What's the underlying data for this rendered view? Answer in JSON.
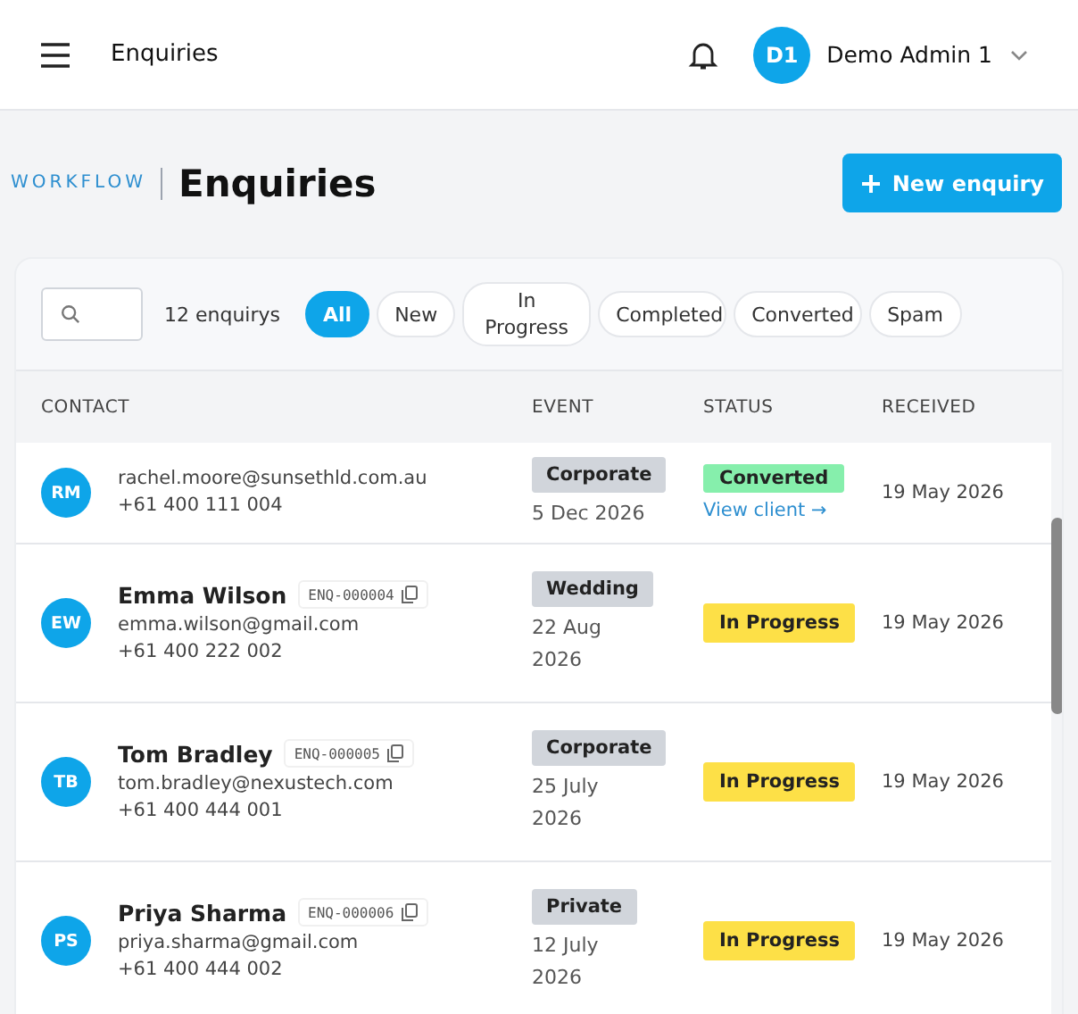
{
  "topbar": {
    "title": "Enquiries",
    "user": {
      "initials": "D1",
      "name": "Demo Admin 1"
    }
  },
  "page": {
    "section": "WORKFLOW",
    "title": "Enquiries",
    "new_button": "New enquiry"
  },
  "filters": {
    "count": "12 enquirys",
    "chips": [
      {
        "label": "All",
        "selected": true
      },
      {
        "label": "New",
        "selected": false
      },
      {
        "label": "In Progress",
        "selected": false
      },
      {
        "label": "Completed",
        "selected": false
      },
      {
        "label": "Converted",
        "selected": false
      },
      {
        "label": "Spam",
        "selected": false
      }
    ]
  },
  "table": {
    "columns": [
      "CONTACT",
      "EVENT",
      "STATUS",
      "RECEIVED"
    ],
    "rows": [
      {
        "initials": "RM",
        "email": "rachel.moore@sunsethld.com.au",
        "phone": "+61 400 111 004",
        "event": "Corporate",
        "event_date": "5 Dec 2026",
        "status": {
          "label": "Converted",
          "kind": "converted"
        },
        "link": "View client →",
        "received": "19 May 2026"
      },
      {
        "initials": "EW",
        "name": "Emma Wilson",
        "ref": "ENQ-000004",
        "email": "emma.wilson@gmail.com",
        "phone": "+61 400 222 002",
        "event": "Wedding",
        "event_date": "22 Aug 2026",
        "status": {
          "label": "In Progress",
          "kind": "progress"
        },
        "received": "19 May 2026"
      },
      {
        "initials": "TB",
        "name": "Tom Bradley",
        "ref": "ENQ-000005",
        "email": "tom.bradley@nexustech.com",
        "phone": "+61 400 444 001",
        "event": "Corporate",
        "event_date": "25 July 2026",
        "status": {
          "label": "In Progress",
          "kind": "progress"
        },
        "received": "19 May 2026"
      },
      {
        "initials": "PS",
        "name": "Priya Sharma",
        "ref": "ENQ-000006",
        "email": "priya.sharma@gmail.com",
        "phone": "+61 400 444 002",
        "event": "Private",
        "event_date": "12 July 2026",
        "status": {
          "label": "In Progress",
          "kind": "progress"
        },
        "received": "19 May 2026"
      }
    ]
  }
}
